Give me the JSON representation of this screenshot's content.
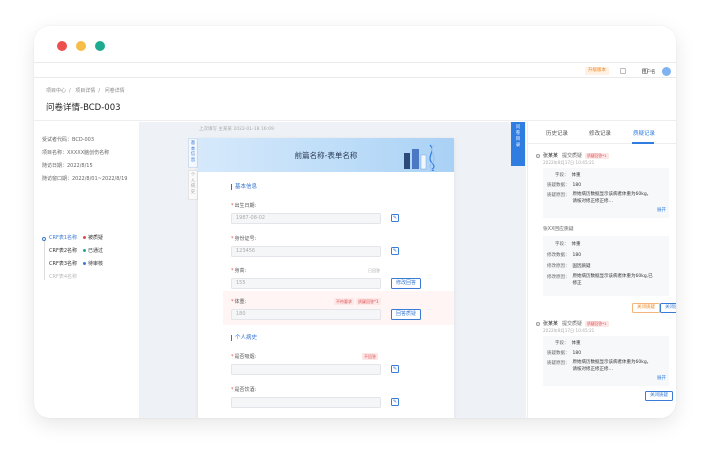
{
  "topbar": {
    "tag": "升级版本",
    "username": "用户名"
  },
  "breadcrumb": [
    "项目中心",
    "项目详情",
    "问卷详情"
  ],
  "page_title": "问卷详情-BCD-003",
  "info": {
    "subject_code": "受试者代码：BCD-003",
    "project_name": "项目名称：XXXXX脑创伤名称",
    "visit_date": "随访日期：2022/8/15",
    "visit_window": "随访窗口期：2022/8/01~2022/8/19"
  },
  "crf_list": [
    {
      "name": "CRF表1名称",
      "status": "被质疑",
      "dot": "#e04b4b",
      "state": "active"
    },
    {
      "name": "CRF表2名称",
      "status": "已通过",
      "dot": "#1fab8f",
      "state": "normal"
    },
    {
      "name": "CRF表3名称",
      "status": "待审核",
      "dot": "#3a7bd5",
      "state": "normal"
    },
    {
      "name": "CRF表4名称",
      "status": "",
      "dot": "",
      "state": "muted"
    }
  ],
  "center": {
    "meta": "上次填写 主某某 2022-01-18 16:09",
    "side_tabs": [
      "基本信息",
      "个人病史"
    ],
    "banner_title": "前篇名称-表单名称",
    "sections": {
      "basic": "基本信息",
      "history": "个人病史"
    },
    "fields": {
      "birth_label": "出生日期:",
      "birth_value": "1987-08-02",
      "id_label": "身份证号:",
      "id_value": "123456",
      "height_label": "身高:",
      "height_value": "155",
      "height_badge": "已回答",
      "height_btn": "修改回答",
      "weight_label": "体重:",
      "weight_value": "180",
      "weight_badge1": "不符要求",
      "weight_badge2": "质疑回答*1",
      "weight_btn": "回答质疑",
      "hist1_label": "是否吸烟:",
      "hist1_badge": "不回答",
      "hist2_label": "是否饮酒:"
    }
  },
  "float_tab": "问卷目录",
  "right": {
    "tabs": [
      "历史记录",
      "修改记录",
      "质疑记录"
    ],
    "query1": {
      "user": "张某某",
      "action": "提交质疑",
      "tag": "质疑回答*1",
      "time": "2022年8月17日  10:45:21",
      "field_label": "字段：",
      "field_value": "体重",
      "data_label": "质疑数据：",
      "data_value": "180",
      "reason_label": "质疑原因：",
      "reason_value": "原始病历数据显示该病者体重为60kg，请核对修正修正修…",
      "expand": "展开",
      "sub": "张XX回应质疑",
      "r_field_label": "字段：",
      "r_field_value": "体重",
      "r_data_label": "修改数据：",
      "r_data_value": "180",
      "r_reason_label": "修改原因：",
      "r_reason_value": "国因质疑",
      "r_reply_label": "修改原因：",
      "r_reply_value": "原始病历数据显示该病者体重为60kg,已修正",
      "btn_close": "关闭质疑",
      "btn_resolve": "关闭质疑"
    },
    "query2": {
      "user": "张某某",
      "action": "提交质疑",
      "tag": "质疑回答*1",
      "time": "2022年8月17日  10:45:21",
      "field_label": "字段：",
      "field_value": "体重",
      "data_label": "质疑数据：",
      "data_value": "180",
      "reason_label": "质疑原因：",
      "reason_value": "原始病历数据显示该病者体重为60kg，请核对修正修正修…",
      "expand": "展开",
      "btn": "关闭质疑"
    }
  }
}
